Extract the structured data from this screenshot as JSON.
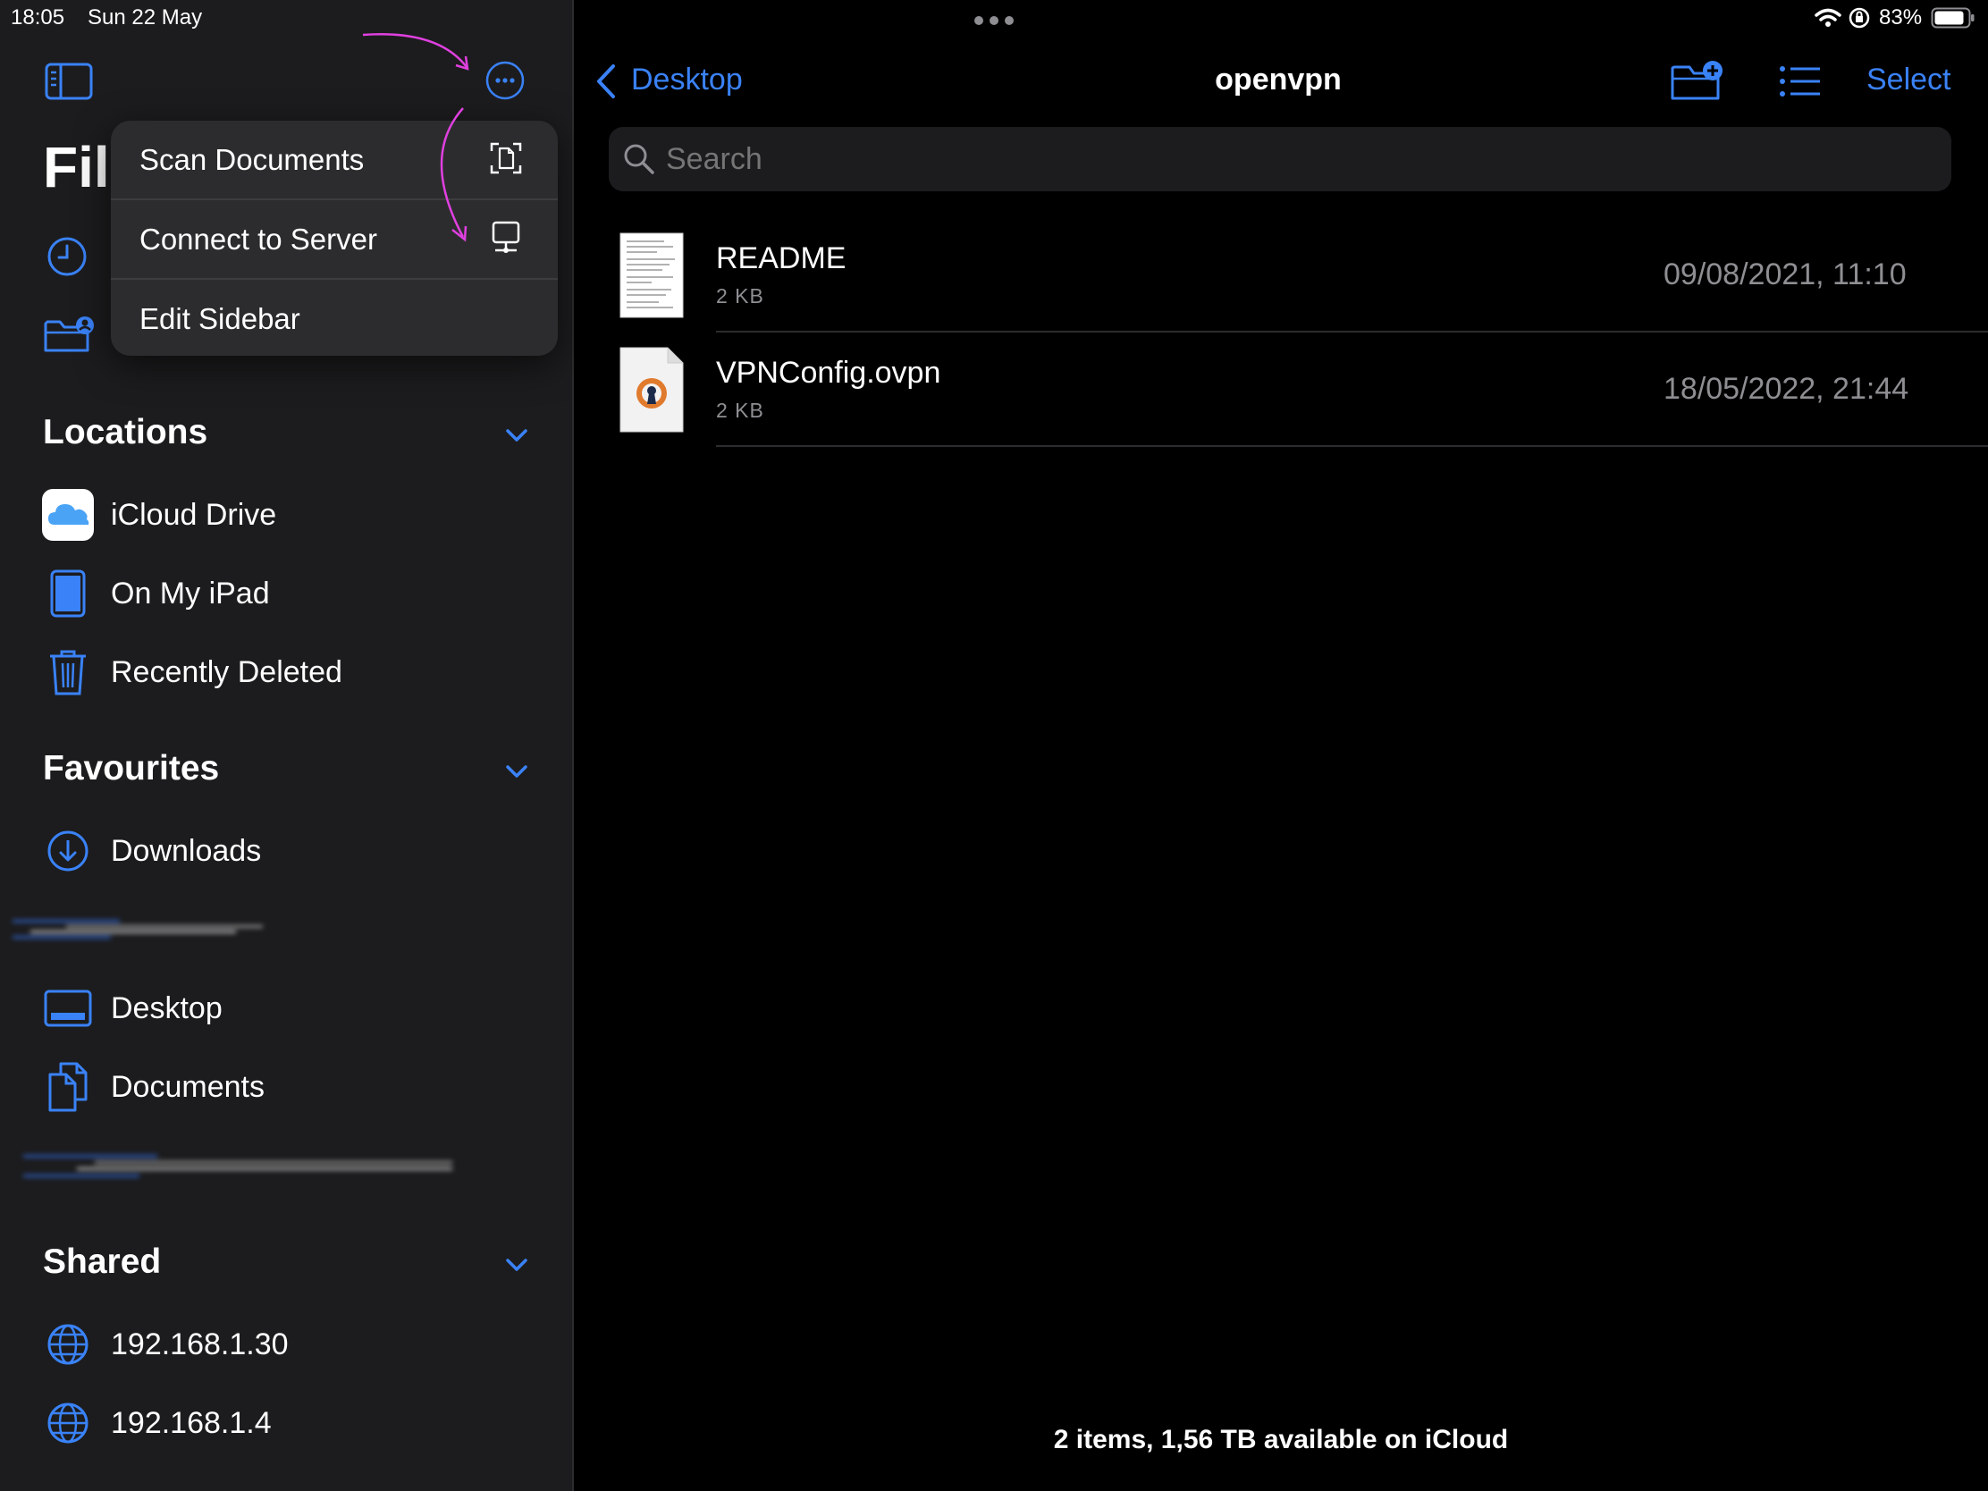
{
  "status_bar": {
    "time": "18:05",
    "date": "Sun 22 May",
    "battery": "83%",
    "icons": [
      "wifi-icon",
      "orientation-lock-icon",
      "battery-icon"
    ]
  },
  "sidebar": {
    "title": "Files",
    "sections": {
      "locations": {
        "title": "Locations",
        "items": [
          {
            "label": "iCloud Drive",
            "icon": "icloud-drive-icon"
          },
          {
            "label": "On My iPad",
            "icon": "ipad-icon"
          },
          {
            "label": "Recently Deleted",
            "icon": "trash-icon"
          }
        ]
      },
      "favourites": {
        "title": "Favourites",
        "items": [
          {
            "label": "Downloads",
            "icon": "download-icon"
          },
          {
            "label": "Desktop",
            "icon": "desktop-icon"
          },
          {
            "label": "Documents",
            "icon": "documents-icon"
          }
        ]
      },
      "shared": {
        "title": "Shared",
        "items": [
          {
            "label": "192.168.1.30",
            "icon": "globe-icon"
          },
          {
            "label": "192.168.1.4",
            "icon": "globe-icon"
          }
        ]
      }
    }
  },
  "menu": {
    "items": [
      {
        "label": "Scan Documents",
        "icon": "scan-document-icon"
      },
      {
        "label": "Connect to Server",
        "icon": "server-icon"
      },
      {
        "label": "Edit Sidebar"
      }
    ]
  },
  "navbar": {
    "back_label": "Desktop",
    "title": "openvpn",
    "select_label": "Select"
  },
  "search": {
    "placeholder": "Search"
  },
  "files": [
    {
      "name": "README",
      "size": "2 KB",
      "date": "09/08/2021, 11:10",
      "icon": "text-document-icon"
    },
    {
      "name": "VPNConfig.ovpn",
      "size": "2 KB",
      "date": "18/05/2022, 21:44",
      "icon": "openvpn-file-icon"
    }
  ],
  "footer": {
    "summary": "2 items, 1,56 TB available on iCloud"
  },
  "colors": {
    "accent": "#3a82f7",
    "sidebar_bg": "#1c1c1e",
    "background": "#000000",
    "annotation_arrow": "#e040e0"
  }
}
